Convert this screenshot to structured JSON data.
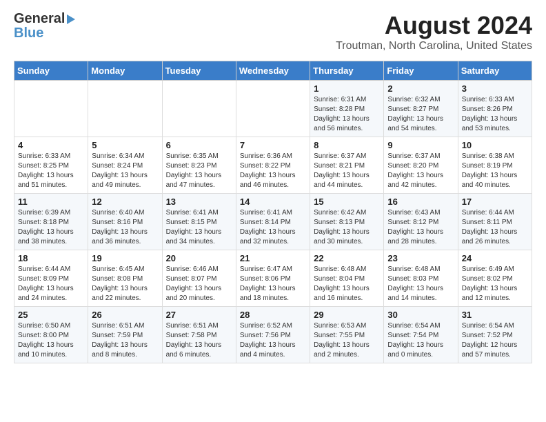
{
  "logo": {
    "general": "General",
    "blue": "Blue"
  },
  "title": {
    "month_year": "August 2024",
    "location": "Troutman, North Carolina, United States"
  },
  "headers": [
    "Sunday",
    "Monday",
    "Tuesday",
    "Wednesday",
    "Thursday",
    "Friday",
    "Saturday"
  ],
  "weeks": [
    [
      {
        "day": "",
        "sunrise": "",
        "sunset": "",
        "daylight": ""
      },
      {
        "day": "",
        "sunrise": "",
        "sunset": "",
        "daylight": ""
      },
      {
        "day": "",
        "sunrise": "",
        "sunset": "",
        "daylight": ""
      },
      {
        "day": "",
        "sunrise": "",
        "sunset": "",
        "daylight": ""
      },
      {
        "day": "1",
        "sunrise": "Sunrise: 6:31 AM",
        "sunset": "Sunset: 8:28 PM",
        "daylight": "Daylight: 13 hours and 56 minutes."
      },
      {
        "day": "2",
        "sunrise": "Sunrise: 6:32 AM",
        "sunset": "Sunset: 8:27 PM",
        "daylight": "Daylight: 13 hours and 54 minutes."
      },
      {
        "day": "3",
        "sunrise": "Sunrise: 6:33 AM",
        "sunset": "Sunset: 8:26 PM",
        "daylight": "Daylight: 13 hours and 53 minutes."
      }
    ],
    [
      {
        "day": "4",
        "sunrise": "Sunrise: 6:33 AM",
        "sunset": "Sunset: 8:25 PM",
        "daylight": "Daylight: 13 hours and 51 minutes."
      },
      {
        "day": "5",
        "sunrise": "Sunrise: 6:34 AM",
        "sunset": "Sunset: 8:24 PM",
        "daylight": "Daylight: 13 hours and 49 minutes."
      },
      {
        "day": "6",
        "sunrise": "Sunrise: 6:35 AM",
        "sunset": "Sunset: 8:23 PM",
        "daylight": "Daylight: 13 hours and 47 minutes."
      },
      {
        "day": "7",
        "sunrise": "Sunrise: 6:36 AM",
        "sunset": "Sunset: 8:22 PM",
        "daylight": "Daylight: 13 hours and 46 minutes."
      },
      {
        "day": "8",
        "sunrise": "Sunrise: 6:37 AM",
        "sunset": "Sunset: 8:21 PM",
        "daylight": "Daylight: 13 hours and 44 minutes."
      },
      {
        "day": "9",
        "sunrise": "Sunrise: 6:37 AM",
        "sunset": "Sunset: 8:20 PM",
        "daylight": "Daylight: 13 hours and 42 minutes."
      },
      {
        "day": "10",
        "sunrise": "Sunrise: 6:38 AM",
        "sunset": "Sunset: 8:19 PM",
        "daylight": "Daylight: 13 hours and 40 minutes."
      }
    ],
    [
      {
        "day": "11",
        "sunrise": "Sunrise: 6:39 AM",
        "sunset": "Sunset: 8:18 PM",
        "daylight": "Daylight: 13 hours and 38 minutes."
      },
      {
        "day": "12",
        "sunrise": "Sunrise: 6:40 AM",
        "sunset": "Sunset: 8:16 PM",
        "daylight": "Daylight: 13 hours and 36 minutes."
      },
      {
        "day": "13",
        "sunrise": "Sunrise: 6:41 AM",
        "sunset": "Sunset: 8:15 PM",
        "daylight": "Daylight: 13 hours and 34 minutes."
      },
      {
        "day": "14",
        "sunrise": "Sunrise: 6:41 AM",
        "sunset": "Sunset: 8:14 PM",
        "daylight": "Daylight: 13 hours and 32 minutes."
      },
      {
        "day": "15",
        "sunrise": "Sunrise: 6:42 AM",
        "sunset": "Sunset: 8:13 PM",
        "daylight": "Daylight: 13 hours and 30 minutes."
      },
      {
        "day": "16",
        "sunrise": "Sunrise: 6:43 AM",
        "sunset": "Sunset: 8:12 PM",
        "daylight": "Daylight: 13 hours and 28 minutes."
      },
      {
        "day": "17",
        "sunrise": "Sunrise: 6:44 AM",
        "sunset": "Sunset: 8:11 PM",
        "daylight": "Daylight: 13 hours and 26 minutes."
      }
    ],
    [
      {
        "day": "18",
        "sunrise": "Sunrise: 6:44 AM",
        "sunset": "Sunset: 8:09 PM",
        "daylight": "Daylight: 13 hours and 24 minutes."
      },
      {
        "day": "19",
        "sunrise": "Sunrise: 6:45 AM",
        "sunset": "Sunset: 8:08 PM",
        "daylight": "Daylight: 13 hours and 22 minutes."
      },
      {
        "day": "20",
        "sunrise": "Sunrise: 6:46 AM",
        "sunset": "Sunset: 8:07 PM",
        "daylight": "Daylight: 13 hours and 20 minutes."
      },
      {
        "day": "21",
        "sunrise": "Sunrise: 6:47 AM",
        "sunset": "Sunset: 8:06 PM",
        "daylight": "Daylight: 13 hours and 18 minutes."
      },
      {
        "day": "22",
        "sunrise": "Sunrise: 6:48 AM",
        "sunset": "Sunset: 8:04 PM",
        "daylight": "Daylight: 13 hours and 16 minutes."
      },
      {
        "day": "23",
        "sunrise": "Sunrise: 6:48 AM",
        "sunset": "Sunset: 8:03 PM",
        "daylight": "Daylight: 13 hours and 14 minutes."
      },
      {
        "day": "24",
        "sunrise": "Sunrise: 6:49 AM",
        "sunset": "Sunset: 8:02 PM",
        "daylight": "Daylight: 13 hours and 12 minutes."
      }
    ],
    [
      {
        "day": "25",
        "sunrise": "Sunrise: 6:50 AM",
        "sunset": "Sunset: 8:00 PM",
        "daylight": "Daylight: 13 hours and 10 minutes."
      },
      {
        "day": "26",
        "sunrise": "Sunrise: 6:51 AM",
        "sunset": "Sunset: 7:59 PM",
        "daylight": "Daylight: 13 hours and 8 minutes."
      },
      {
        "day": "27",
        "sunrise": "Sunrise: 6:51 AM",
        "sunset": "Sunset: 7:58 PM",
        "daylight": "Daylight: 13 hours and 6 minutes."
      },
      {
        "day": "28",
        "sunrise": "Sunrise: 6:52 AM",
        "sunset": "Sunset: 7:56 PM",
        "daylight": "Daylight: 13 hours and 4 minutes."
      },
      {
        "day": "29",
        "sunrise": "Sunrise: 6:53 AM",
        "sunset": "Sunset: 7:55 PM",
        "daylight": "Daylight: 13 hours and 2 minutes."
      },
      {
        "day": "30",
        "sunrise": "Sunrise: 6:54 AM",
        "sunset": "Sunset: 7:54 PM",
        "daylight": "Daylight: 13 hours and 0 minutes."
      },
      {
        "day": "31",
        "sunrise": "Sunrise: 6:54 AM",
        "sunset": "Sunset: 7:52 PM",
        "daylight": "Daylight: 12 hours and 57 minutes."
      }
    ]
  ]
}
